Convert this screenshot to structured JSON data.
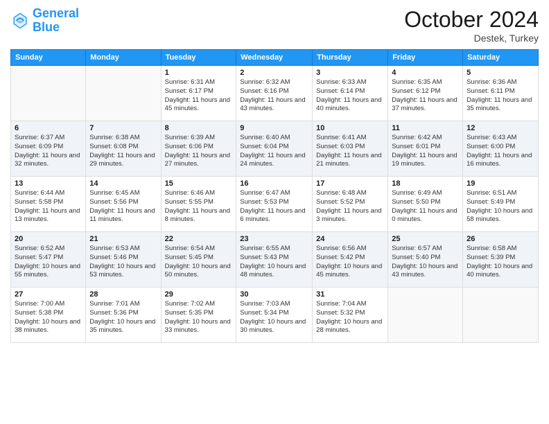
{
  "header": {
    "logo_line1": "General",
    "logo_line2": "Blue",
    "month": "October 2024",
    "location": "Destek, Turkey"
  },
  "days_of_week": [
    "Sunday",
    "Monday",
    "Tuesday",
    "Wednesday",
    "Thursday",
    "Friday",
    "Saturday"
  ],
  "weeks": [
    [
      {
        "day": "",
        "info": ""
      },
      {
        "day": "",
        "info": ""
      },
      {
        "day": "1",
        "info": "Sunrise: 6:31 AM\nSunset: 6:17 PM\nDaylight: 11 hours and 45 minutes."
      },
      {
        "day": "2",
        "info": "Sunrise: 6:32 AM\nSunset: 6:16 PM\nDaylight: 11 hours and 43 minutes."
      },
      {
        "day": "3",
        "info": "Sunrise: 6:33 AM\nSunset: 6:14 PM\nDaylight: 11 hours and 40 minutes."
      },
      {
        "day": "4",
        "info": "Sunrise: 6:35 AM\nSunset: 6:12 PM\nDaylight: 11 hours and 37 minutes."
      },
      {
        "day": "5",
        "info": "Sunrise: 6:36 AM\nSunset: 6:11 PM\nDaylight: 11 hours and 35 minutes."
      }
    ],
    [
      {
        "day": "6",
        "info": "Sunrise: 6:37 AM\nSunset: 6:09 PM\nDaylight: 11 hours and 32 minutes."
      },
      {
        "day": "7",
        "info": "Sunrise: 6:38 AM\nSunset: 6:08 PM\nDaylight: 11 hours and 29 minutes."
      },
      {
        "day": "8",
        "info": "Sunrise: 6:39 AM\nSunset: 6:06 PM\nDaylight: 11 hours and 27 minutes."
      },
      {
        "day": "9",
        "info": "Sunrise: 6:40 AM\nSunset: 6:04 PM\nDaylight: 11 hours and 24 minutes."
      },
      {
        "day": "10",
        "info": "Sunrise: 6:41 AM\nSunset: 6:03 PM\nDaylight: 11 hours and 21 minutes."
      },
      {
        "day": "11",
        "info": "Sunrise: 6:42 AM\nSunset: 6:01 PM\nDaylight: 11 hours and 19 minutes."
      },
      {
        "day": "12",
        "info": "Sunrise: 6:43 AM\nSunset: 6:00 PM\nDaylight: 11 hours and 16 minutes."
      }
    ],
    [
      {
        "day": "13",
        "info": "Sunrise: 6:44 AM\nSunset: 5:58 PM\nDaylight: 11 hours and 13 minutes."
      },
      {
        "day": "14",
        "info": "Sunrise: 6:45 AM\nSunset: 5:56 PM\nDaylight: 11 hours and 11 minutes."
      },
      {
        "day": "15",
        "info": "Sunrise: 6:46 AM\nSunset: 5:55 PM\nDaylight: 11 hours and 8 minutes."
      },
      {
        "day": "16",
        "info": "Sunrise: 6:47 AM\nSunset: 5:53 PM\nDaylight: 11 hours and 6 minutes."
      },
      {
        "day": "17",
        "info": "Sunrise: 6:48 AM\nSunset: 5:52 PM\nDaylight: 11 hours and 3 minutes."
      },
      {
        "day": "18",
        "info": "Sunrise: 6:49 AM\nSunset: 5:50 PM\nDaylight: 11 hours and 0 minutes."
      },
      {
        "day": "19",
        "info": "Sunrise: 6:51 AM\nSunset: 5:49 PM\nDaylight: 10 hours and 58 minutes."
      }
    ],
    [
      {
        "day": "20",
        "info": "Sunrise: 6:52 AM\nSunset: 5:47 PM\nDaylight: 10 hours and 55 minutes."
      },
      {
        "day": "21",
        "info": "Sunrise: 6:53 AM\nSunset: 5:46 PM\nDaylight: 10 hours and 53 minutes."
      },
      {
        "day": "22",
        "info": "Sunrise: 6:54 AM\nSunset: 5:45 PM\nDaylight: 10 hours and 50 minutes."
      },
      {
        "day": "23",
        "info": "Sunrise: 6:55 AM\nSunset: 5:43 PM\nDaylight: 10 hours and 48 minutes."
      },
      {
        "day": "24",
        "info": "Sunrise: 6:56 AM\nSunset: 5:42 PM\nDaylight: 10 hours and 45 minutes."
      },
      {
        "day": "25",
        "info": "Sunrise: 6:57 AM\nSunset: 5:40 PM\nDaylight: 10 hours and 43 minutes."
      },
      {
        "day": "26",
        "info": "Sunrise: 6:58 AM\nSunset: 5:39 PM\nDaylight: 10 hours and 40 minutes."
      }
    ],
    [
      {
        "day": "27",
        "info": "Sunrise: 7:00 AM\nSunset: 5:38 PM\nDaylight: 10 hours and 38 minutes."
      },
      {
        "day": "28",
        "info": "Sunrise: 7:01 AM\nSunset: 5:36 PM\nDaylight: 10 hours and 35 minutes."
      },
      {
        "day": "29",
        "info": "Sunrise: 7:02 AM\nSunset: 5:35 PM\nDaylight: 10 hours and 33 minutes."
      },
      {
        "day": "30",
        "info": "Sunrise: 7:03 AM\nSunset: 5:34 PM\nDaylight: 10 hours and 30 minutes."
      },
      {
        "day": "31",
        "info": "Sunrise: 7:04 AM\nSunset: 5:32 PM\nDaylight: 10 hours and 28 minutes."
      },
      {
        "day": "",
        "info": ""
      },
      {
        "day": "",
        "info": ""
      }
    ]
  ]
}
